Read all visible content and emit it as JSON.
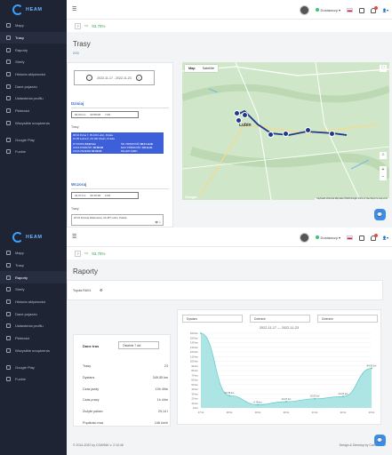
{
  "brand": {
    "logo_text": "HEAM"
  },
  "nav": {
    "items": [
      "Mapy",
      "Trasy",
      "Raporty",
      "Strefy",
      "Historia aktywności",
      "Dane pojazdu",
      "Ustawienia profilu",
      "Płatności",
      "Wszystkie urządzenia"
    ],
    "extra": [
      "Google Play",
      "Funkie"
    ]
  },
  "topbar": {
    "status": "Dostawczy"
  },
  "subbar": {
    "percent": "93.75%"
  },
  "trasy": {
    "title": "Trasy",
    "link": "XXX",
    "date_range": "2022-11-17 - 2022-11-23",
    "today": {
      "heading": "Dzisiaj",
      "distance": "84,93 km",
      "duration": "00:58:08",
      "trips": "7.08",
      "trips_label": "Trasy",
      "trip": {
        "start": "08:40 Polna 7, 05-100 Lubin, Polska",
        "end": "10:05 Leśna 6, 23-100 Chełm, Polska",
        "c1": [
          [
            "DYSTANS",
            "84,93 km"
          ],
          [
            "CZAS PODRÓŻY",
            "00:58:08"
          ],
          [
            "CZAS PRZERW",
            "00:00:00"
          ]
        ],
        "c2": [
          [
            "ŚR. PRĘDKOŚĆ",
            "88,51 km/h"
          ],
          [
            "MAX PRĘDKOŚĆ",
            "146 km/h"
          ],
          [
            "PALIWO",
            "3,00 l"
          ]
        ]
      }
    },
    "yesterday": {
      "heading": "Wczoraj",
      "distance": "24,97 km",
      "duration": "00:15:38",
      "trips": "2.08",
      "trips_label": "Trasy",
      "trip_text": "18:33 Kolonia Walentowa, 20-457 Lubin, Polska"
    },
    "map": {
      "tab_map": "Map",
      "tab_sat": "Satellite",
      "city": "Lubin",
      "attrib": "Keyboard shortcuts   Map data ©2022 Google   Terms of Use   Report a map error"
    }
  },
  "raporty": {
    "title": "Raporty",
    "filter_label": "Toyota RAV4",
    "range_card_title": "Dane tras",
    "range_select": "Ostatnie 7 dni",
    "stats": [
      [
        "Trasy",
        "23"
      ],
      [
        "Dystans",
        "349,55 km"
      ],
      [
        "Czas jazdy",
        "10h 49m"
      ],
      [
        "Czas pracy",
        "1h 44m"
      ],
      [
        "Zużyte paliwo",
        "29,14 l"
      ],
      [
        "Prędkość max",
        "146 km/h"
      ]
    ],
    "chart_selects": [
      "Dystans",
      "Dziennie",
      "Dziennie"
    ],
    "chart_title": "2022-11-17 — 2022-11-23",
    "footer_left": "© 2014-2022 by CGARAK v. 2.10.46",
    "footer_right": "Design & Develop by Camo Code"
  },
  "chart_data": {
    "type": "area",
    "categories": [
      "17 lis",
      "18 lis",
      "19 lis",
      "20 lis",
      "21 lis",
      "22 lis",
      "23 lis"
    ],
    "values": [
      160,
      26.45,
      6.78,
      13.37,
      19.53,
      24.37,
      84.93
    ],
    "value_labels": [
      "",
      "26.45 km",
      "6.78 km",
      "13.37 km",
      "19.53 km",
      "24.37 km",
      "84.93 km"
    ],
    "ylim": [
      0,
      160
    ],
    "yticks": [
      "0 km",
      "10 km",
      "20 km",
      "30 km",
      "40 km",
      "50 km",
      "60 km",
      "70 km",
      "80 km",
      "90 km",
      "100 km",
      "110 km",
      "120 km",
      "130 km",
      "140 km",
      "150 km",
      "160 km"
    ],
    "color": "#9fe0e0"
  }
}
